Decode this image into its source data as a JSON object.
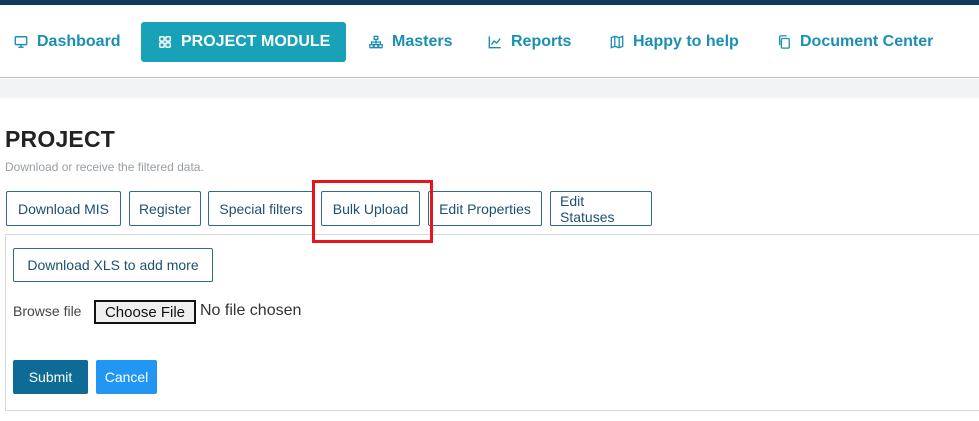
{
  "nav": {
    "items": [
      {
        "label": "Dashboard",
        "icon": "monitor-icon"
      },
      {
        "label": "PROJECT MODULE",
        "icon": "grid-icon",
        "active": true
      },
      {
        "label": "Masters",
        "icon": "sitemap-icon"
      },
      {
        "label": "Reports",
        "icon": "line-chart-icon"
      },
      {
        "label": "Happy to help",
        "icon": "map-icon"
      },
      {
        "label": "Document Center",
        "icon": "copy-icon"
      }
    ]
  },
  "page": {
    "title": "PROJECT",
    "subtitle": "Download or receive the filtered data."
  },
  "tabs": [
    {
      "label": "Download MIS"
    },
    {
      "label": "Register"
    },
    {
      "label": "Special filters"
    },
    {
      "label": "Bulk Upload",
      "highlighted": true
    },
    {
      "label": "Edit Properties"
    },
    {
      "label": "Edit Statuses"
    }
  ],
  "bulk_upload": {
    "download_xls_label": "Download XLS to add more",
    "browse_label": "Browse file",
    "choose_file_label": "Choose File",
    "no_file_label": "No file chosen",
    "submit_label": "Submit",
    "cancel_label": "Cancel"
  },
  "colors": {
    "accent": "#17a2b8",
    "nav_text": "#1a8fb3",
    "header_stripe": "#0d3a5c",
    "highlight": "#e8141c",
    "submit": "#0e6b95",
    "cancel": "#2196f3"
  }
}
